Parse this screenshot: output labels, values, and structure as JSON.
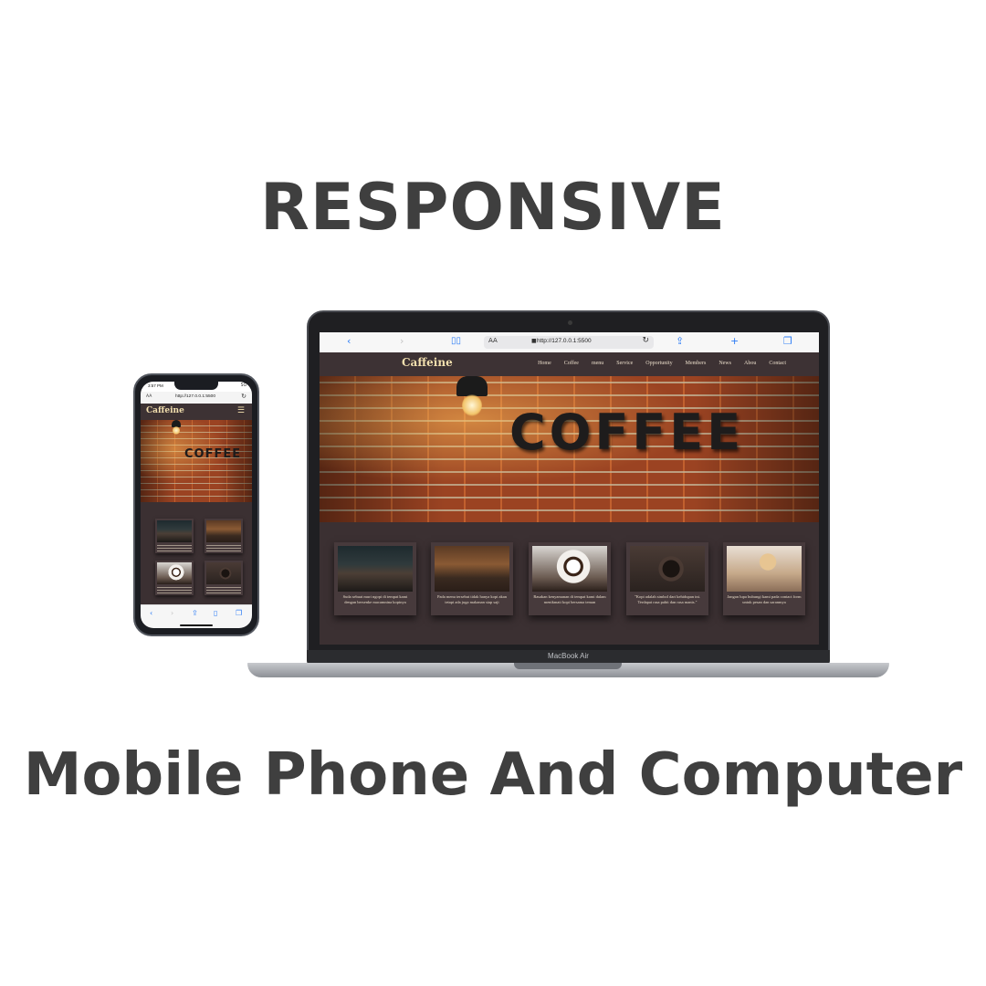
{
  "headline": {
    "top": "RESPONSIVE",
    "bottom": "Mobile Phone And Computer"
  },
  "laptop": {
    "model_label": "MacBook Air",
    "browser": {
      "text_size_label": "AA",
      "url": "http://127.0.0.1:5500",
      "icons": [
        "chevron-left-icon",
        "chevron-right-icon",
        "book-icon",
        "lock-icon",
        "reload-icon",
        "share-icon",
        "plus-icon",
        "tabs-icon"
      ]
    },
    "site": {
      "brand": "Caffeine",
      "nav": [
        "Home",
        "Coffee",
        "menu",
        "Service",
        "Opportunity",
        "Members",
        "News",
        "Abou",
        "Contact"
      ],
      "hero_word": "COFFEE",
      "cards": [
        {
          "text": "Suda sebuat muri ngopi di tempat kami dengan bersenke macamnina kopinya"
        },
        {
          "text": "Pada menu tersebut tidak hanya kopi akan tetapi ada juga makanan siap saji"
        },
        {
          "text": "Rasakan kenyamanan di tempat kami dalam menikmati kopi bersama teman"
        },
        {
          "text": "\"Kopi adalah simbol dari kehidupan ini. Terdapat rasa pahit dan rasa manis.\""
        },
        {
          "text": "Jangan lupa hubungi kami pada contact form untuk pesan dan saranmya"
        }
      ]
    }
  },
  "phone": {
    "status": {
      "time": "3:57 PM",
      "signal": "5G"
    },
    "browser": {
      "text_size_label": "AA",
      "url": "http://127.0.0.1:5500"
    },
    "site": {
      "brand": "Caffeine",
      "hero_word": "COFFEE",
      "menu_icon": "hamburger-icon"
    }
  }
}
